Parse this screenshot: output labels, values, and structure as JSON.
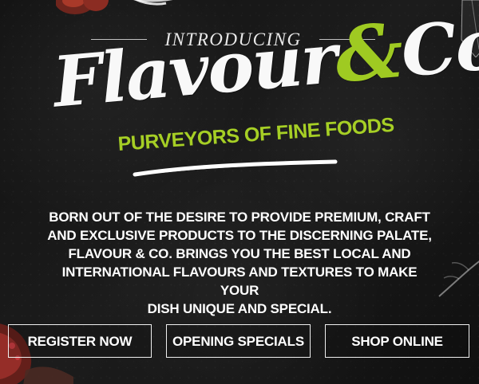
{
  "hero": {
    "intro": "INTRODUCING",
    "brand": {
      "flavour": "Flavour",
      "ampersand": "&",
      "co": "Co.",
      "tagline": "PURVEYORS OF FINE FOODS"
    },
    "description": "BORN OUT OF THE DESIRE TO PROVIDE PREMIUM, CRAFT\nAND EXCLUSIVE PRODUCTS TO THE DISCERNING PALATE,\nFLAVOUR & CO. BRINGS YOU THE BEST LOCAL AND\nINTERNATIONAL FLAVOURS AND TEXTURES TO MAKE YOUR\nDISH UNIQUE AND SPECIAL.",
    "buttons": {
      "register": "REGISTER NOW",
      "specials": "OPENING SPECIALS",
      "shop": "SHOP ONLINE"
    }
  },
  "colors": {
    "background": "#161616",
    "accent": "#a6cf25",
    "text": "#ffffff"
  },
  "icons": {
    "decorative_food": "food-photo-icon",
    "decorative_glass": "glass-icon",
    "decorative_branch": "herb-icon"
  }
}
